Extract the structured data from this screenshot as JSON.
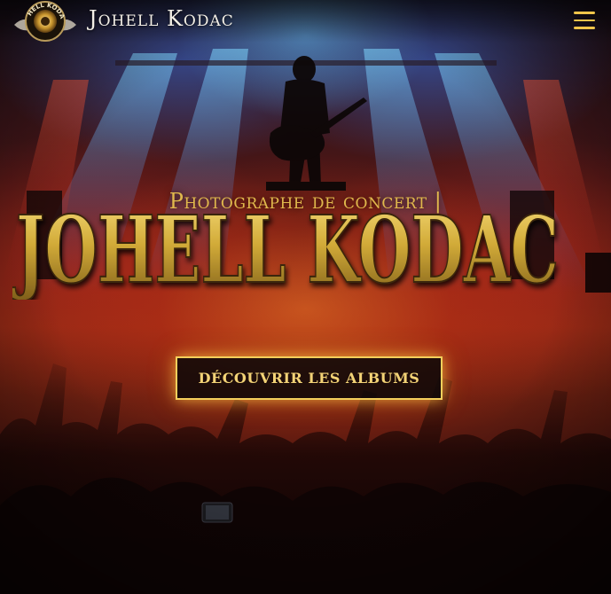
{
  "header": {
    "brand": "Johell Kodac",
    "logo_text": "JOHELL KODAC",
    "menu_icon": "hamburger-menu-icon"
  },
  "hero": {
    "subtitle": "Photographe de concert |",
    "title": "JOHELL KODAC",
    "cta_label": "DÉCOUVRIR LES ALBUMS"
  },
  "colors": {
    "accent_gold": "#f0c54a",
    "title_gold": "#c9a32e",
    "background_dark": "#1a0708"
  }
}
